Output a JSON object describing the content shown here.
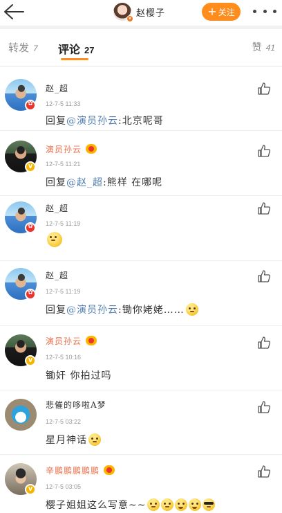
{
  "header": {
    "back_icon": "back-arrow-icon",
    "author_name": "赵樱子",
    "follow_label": "关注",
    "more_icon": "more-dots-icon"
  },
  "tabs": {
    "repost_label": "转发",
    "repost_count": "7",
    "comment_label": "评论",
    "comment_count": "27",
    "like_label": "赞",
    "like_count": "41"
  },
  "comments": [
    {
      "name": "赵_超",
      "time": "12-7-5 11:33",
      "reply_prefix": "回复",
      "mention": "@演员孙云",
      "text": ":北京呢哥"
    },
    {
      "name": "演员孙云",
      "time": "12-7-5 11:21",
      "reply_prefix": "回复",
      "mention": "@赵_超",
      "text": ":熊样 在哪呢"
    },
    {
      "name": "赵_超",
      "time": "12-7-5 11:19",
      "text": ""
    },
    {
      "name": "赵_超",
      "time": "12-7-5 11:19",
      "reply_prefix": "回复",
      "mention": "@演员孙云",
      "text": ":锄你姥姥……"
    },
    {
      "name": "演员孙云",
      "time": "12-7-5 10:16",
      "text": "锄奸 你拍过吗"
    },
    {
      "name": "悲催的哆啦A梦",
      "time": "12-7-5 03:22",
      "text": "星月神话"
    },
    {
      "name": "辛鹏鹏鹏鹏鹏",
      "time": "12-7-5 03:05",
      "text": "樱子姐姐这么写意~~"
    }
  ],
  "colors": {
    "accent": "#ff8d1d",
    "mention": "#507daf",
    "vip_name": "#eb7350"
  }
}
